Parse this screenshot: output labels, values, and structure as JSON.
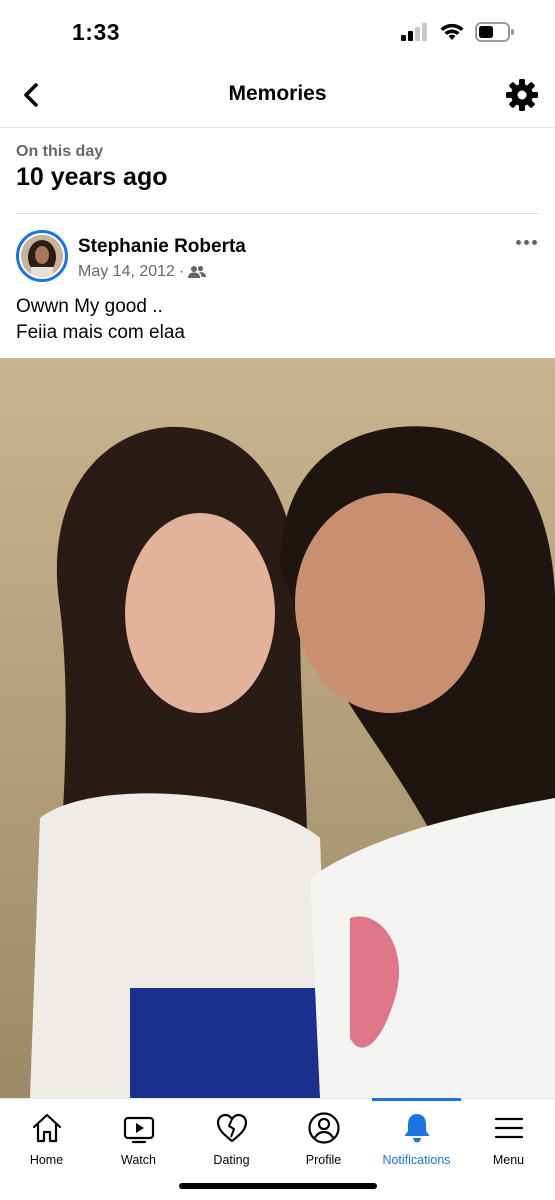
{
  "status_bar": {
    "time": "1:33",
    "icons": [
      "signal-icon",
      "wifi-icon",
      "battery-icon"
    ]
  },
  "nav": {
    "title": "Memories",
    "back_icon": "chevron-left-icon",
    "settings_icon": "gear-icon"
  },
  "memory": {
    "label": "On this day",
    "heading": "10 years ago"
  },
  "post": {
    "author": "Stephanie Roberta",
    "date": "May 14, 2012",
    "separator": "·",
    "audience_icon": "friends-icon",
    "text_lines": [
      "Owwn My good ..",
      "Feiia mais com elaa"
    ],
    "more_icon": "more-horizontal-icon"
  },
  "tab_bar": {
    "tabs": [
      {
        "label": "Home",
        "icon": "home-icon",
        "active": false
      },
      {
        "label": "Watch",
        "icon": "watch-icon",
        "active": false
      },
      {
        "label": "Dating",
        "icon": "dating-heart-icon",
        "active": false
      },
      {
        "label": "Profile",
        "icon": "profile-icon",
        "active": false
      },
      {
        "label": "Notifications",
        "icon": "bell-icon",
        "active": true
      },
      {
        "label": "Menu",
        "icon": "menu-icon",
        "active": false
      }
    ]
  },
  "colors": {
    "accent": "#1b74e4",
    "secondary_text": "#65676b",
    "divider": "#dadde1"
  }
}
